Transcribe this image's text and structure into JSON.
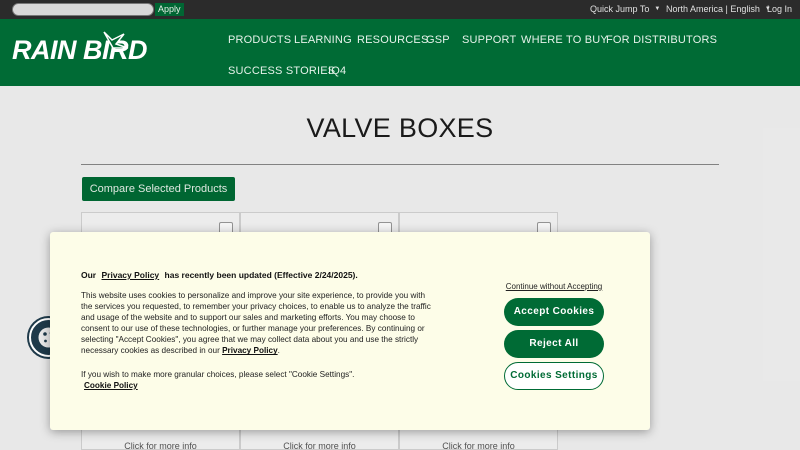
{
  "topbar": {
    "search_placeholder": "",
    "apply_label": "Apply",
    "quick_jump_label": "Quick Jump To",
    "region_label": "North America | English",
    "login_label": "Log In"
  },
  "header": {
    "logo_text": "RAIN BIRD",
    "nav_items": [
      "PRODUCTS",
      "LEARNING",
      "RESOURCES",
      "GSP",
      "SUPPORT",
      "WHERE TO BUY",
      "FOR DISTRIBUTORS",
      "SUCCESS STORIES",
      "IQ4"
    ]
  },
  "page": {
    "title": "VALVE BOXES",
    "compare_button": "Compare Selected Products",
    "card_link": "Click for more info"
  },
  "consent": {
    "head_prefix": "Our",
    "head_link": "Privacy Policy",
    "head_suffix": "has recently been updated (Effective 2/24/2025).",
    "body_text": "This website uses cookies to personalize and improve your site experience, to provide you with the services you requested, to remember your privacy choices, to enable us to analyze the traffic and usage of the website and to support our sales and marketing efforts. You may choose to consent to our use of these technologies, or further manage your preferences. By continuing or selecting \"Accept Cookies\", you agree that we may collect data about you and use the strictly necessary cookies as described in our",
    "body_link": "Privacy Policy",
    "body_end": ".",
    "extra_text": "If you wish to make more granular choices, please select \"Cookie Settings\".",
    "cookie_policy_link": "Cookie Policy",
    "continue_label": "Continue without Accepting",
    "accept_label": "Accept Cookies",
    "reject_label": "Reject All",
    "settings_label": "Cookies Settings"
  },
  "colors": {
    "brand_green": "#006b35",
    "topbar": "#2b2b2b",
    "modal_bg": "#fdfde8"
  }
}
